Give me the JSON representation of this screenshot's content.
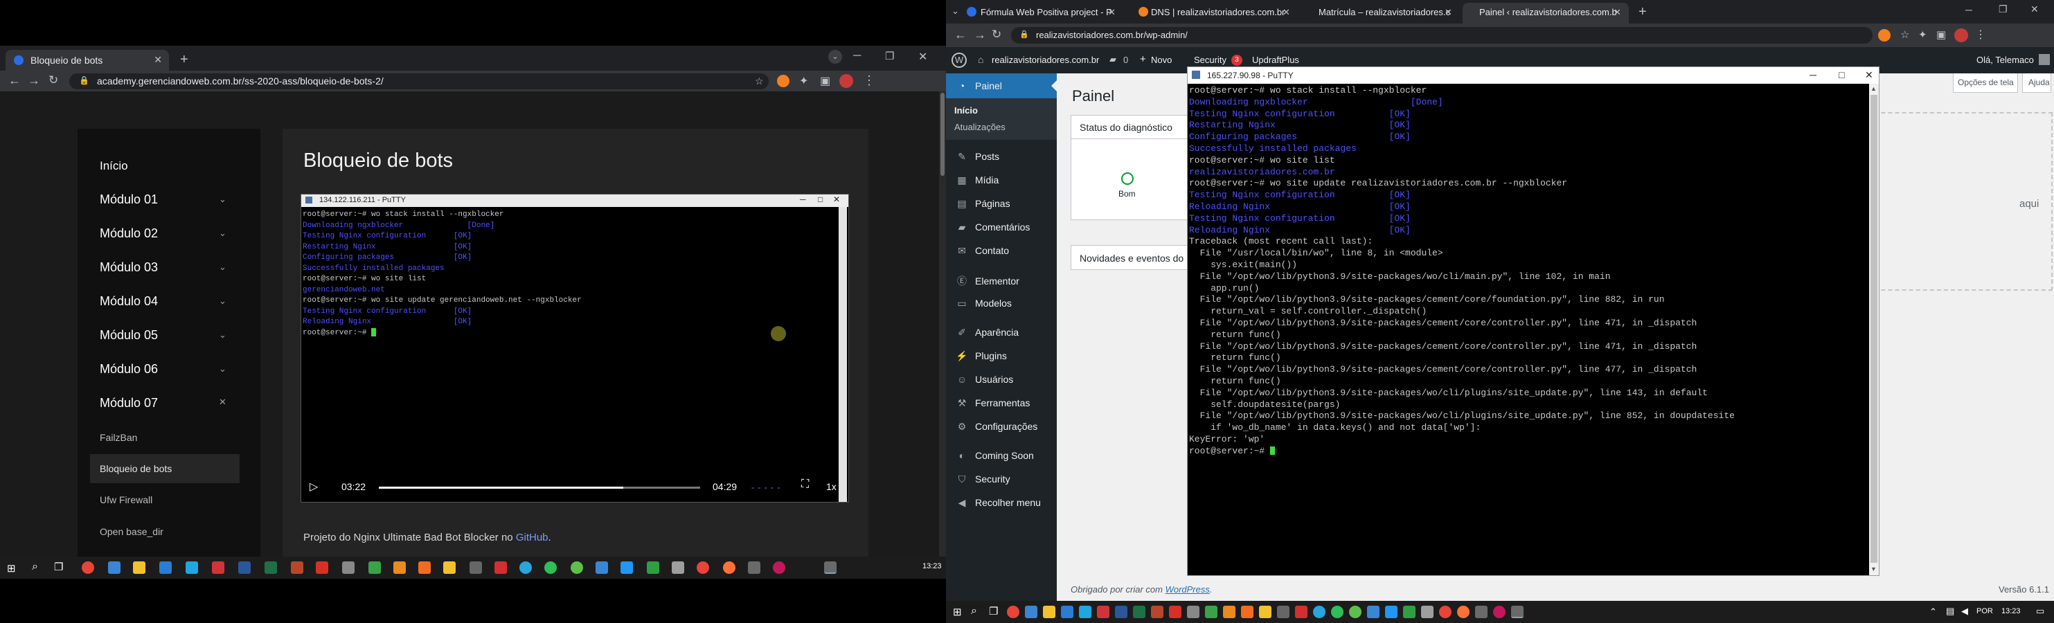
{
  "left": {
    "browser": {
      "tab_title": "Bloqueio de bots",
      "url": "academy.gerenciandoweb.com.br/ss-2020-ass/bloqueio-de-bots-2/"
    },
    "sidebar": {
      "items": [
        {
          "label": "Início"
        },
        {
          "label": "Módulo 01"
        },
        {
          "label": "Módulo 02"
        },
        {
          "label": "Módulo 03"
        },
        {
          "label": "Módulo 04"
        },
        {
          "label": "Módulo 05"
        },
        {
          "label": "Módulo 06"
        },
        {
          "label": "Módulo 07"
        }
      ],
      "subitems": [
        {
          "label": "FailzBan"
        },
        {
          "label": "Bloqueio de bots"
        },
        {
          "label": "Ufw Firewall"
        },
        {
          "label": "Open base_dir"
        }
      ]
    },
    "lesson": {
      "title": "Bloqueio de bots",
      "putty_title": "134.122.116.211 - PuTTY",
      "terminal": [
        {
          "t": "root@server:~# wo stack install --ngxblocker",
          "c": "white"
        },
        {
          "t": "Downloading ngxblocker              [Done]",
          "c": "blue"
        },
        {
          "t": "Testing Nginx configuration      [OK]",
          "c": "blue"
        },
        {
          "t": "Restarting Nginx                 [OK]",
          "c": "blue"
        },
        {
          "t": "Configuring packages             [OK]",
          "c": "blue"
        },
        {
          "t": "Successfully installed packages",
          "c": "blue"
        },
        {
          "t": "root@server:~# wo site list",
          "c": "white"
        },
        {
          "t": "gerenciandoweb.net",
          "c": "blue"
        },
        {
          "t": "root@server:~# wo site update gerenciandoweb.net --ngxblocker",
          "c": "white"
        },
        {
          "t": "Testing Nginx configuration      [OK]",
          "c": "blue"
        },
        {
          "t": "Reloading Nginx                  [OK]",
          "c": "blue"
        },
        {
          "t": "root@server:~# ",
          "c": "white"
        }
      ],
      "video": {
        "current": "03:22",
        "duration": "04:29",
        "speed": "1x",
        "progress": 0.76
      },
      "caption_prefix": "Projeto do Nginx Ultimate Bad Bot Blocker no ",
      "caption_link": "GitHub",
      "caption_suffix": "."
    },
    "taskbar": {
      "time": "13:23"
    }
  },
  "right": {
    "browser": {
      "tabs": [
        {
          "label": "Fórmula Web Positiva project - P"
        },
        {
          "label": "DNS | realizavistoriadores.com.br"
        },
        {
          "label": "Matrícula – realizavistoriadores.c"
        },
        {
          "label": "Painel ‹ realizavistoriadores.com.b"
        }
      ],
      "url": "realizavistoriadores.com.br/wp-admin/"
    },
    "wpbar": {
      "site": "realizavistoriadores.com.br",
      "comments": "0",
      "new": "Novo",
      "security": "Security",
      "security_badge": "3",
      "updraft": "UpdraftPlus",
      "greeting": "Olá, Telemaco"
    },
    "wpmenu": [
      {
        "label": "Painel"
      },
      {
        "label": "Início"
      },
      {
        "label": "Atualizações"
      },
      {
        "label": "Posts"
      },
      {
        "label": "Mídia"
      },
      {
        "label": "Páginas"
      },
      {
        "label": "Comentários"
      },
      {
        "label": "Contato"
      },
      {
        "label": "Elementor"
      },
      {
        "label": "Modelos"
      },
      {
        "label": "Aparência"
      },
      {
        "label": "Plugins"
      },
      {
        "label": "Usuários"
      },
      {
        "label": "Ferramentas"
      },
      {
        "label": "Configurações"
      },
      {
        "label": "Coming Soon"
      },
      {
        "label": "Security"
      },
      {
        "label": "Recolher menu"
      }
    ],
    "dashboard": {
      "title": "Painel",
      "screen_options": "Opções de tela",
      "help": "Ajuda",
      "status_title": "Status do diagnóstico",
      "status_value": "Bom",
      "news_title": "Novidades e eventos do",
      "drop_hint": "aqui",
      "footer": "Obrigado por criar com ",
      "footer_link": "WordPress",
      "footer_dot": ".",
      "version": "Versão 6.1.1"
    },
    "putty_title": "165.227.90.98 - PuTTY",
    "terminal": [
      {
        "t": "root@server:~# wo stack install --ngxblocker",
        "c": "white"
      },
      {
        "t": "Downloading ngxblocker                   [Done]",
        "c": "blue"
      },
      {
        "t": "Testing Nginx configuration          [OK]",
        "c": "blue"
      },
      {
        "t": "Restarting Nginx                     [OK]",
        "c": "blue"
      },
      {
        "t": "Configuring packages                 [OK]",
        "c": "blue"
      },
      {
        "t": "Successfully installed packages",
        "c": "blue"
      },
      {
        "t": "root@server:~# wo site list",
        "c": "white"
      },
      {
        "t": "realizavistoriadores.com.br",
        "c": "blue"
      },
      {
        "t": "root@server:~# wo site update realizavistoriadores.com.br --ngxblocker",
        "c": "white"
      },
      {
        "t": "Testing Nginx configuration          [OK]",
        "c": "blue"
      },
      {
        "t": "Reloading Nginx                      [OK]",
        "c": "blue"
      },
      {
        "t": "Testing Nginx configuration          [OK]",
        "c": "blue"
      },
      {
        "t": "Reloading Nginx                      [OK]",
        "c": "blue"
      },
      {
        "t": "Traceback (most recent call last):",
        "c": "white"
      },
      {
        "t": "  File \"/usr/local/bin/wo\", line 8, in <module>",
        "c": "white"
      },
      {
        "t": "    sys.exit(main())",
        "c": "white"
      },
      {
        "t": "  File \"/opt/wo/lib/python3.9/site-packages/wo/cli/main.py\", line 102, in main",
        "c": "white"
      },
      {
        "t": "    app.run()",
        "c": "white"
      },
      {
        "t": "  File \"/opt/wo/lib/python3.9/site-packages/cement/core/foundation.py\", line 882, in run",
        "c": "white"
      },
      {
        "t": "    return_val = self.controller._dispatch()",
        "c": "white"
      },
      {
        "t": "  File \"/opt/wo/lib/python3.9/site-packages/cement/core/controller.py\", line 471, in _dispatch",
        "c": "white"
      },
      {
        "t": "    return func()",
        "c": "white"
      },
      {
        "t": "  File \"/opt/wo/lib/python3.9/site-packages/cement/core/controller.py\", line 471, in _dispatch",
        "c": "white"
      },
      {
        "t": "    return func()",
        "c": "white"
      },
      {
        "t": "  File \"/opt/wo/lib/python3.9/site-packages/cement/core/controller.py\", line 477, in _dispatch",
        "c": "white"
      },
      {
        "t": "    return func()",
        "c": "white"
      },
      {
        "t": "  File \"/opt/wo/lib/python3.9/site-packages/wo/cli/plugins/site_update.py\", line 143, in default",
        "c": "white"
      },
      {
        "t": "    self.doupdatesite(pargs)",
        "c": "white"
      },
      {
        "t": "  File \"/opt/wo/lib/python3.9/site-packages/wo/cli/plugins/site_update.py\", line 852, in doupdatesite",
        "c": "white"
      },
      {
        "t": "    if 'wo_db_name' in data.keys() and not data['wp']:",
        "c": "white"
      },
      {
        "t": "KeyError: 'wp'",
        "c": "white"
      },
      {
        "t": "root@server:~# ",
        "c": "white"
      }
    ],
    "taskbar": {
      "lang": "POR",
      "time": "13:23"
    }
  },
  "colors": {
    "wp_blue": "#2271b1",
    "chrome_dark": "#202124",
    "terminal_blue": "#5050ff",
    "terminal_green": "#3ae03a"
  }
}
